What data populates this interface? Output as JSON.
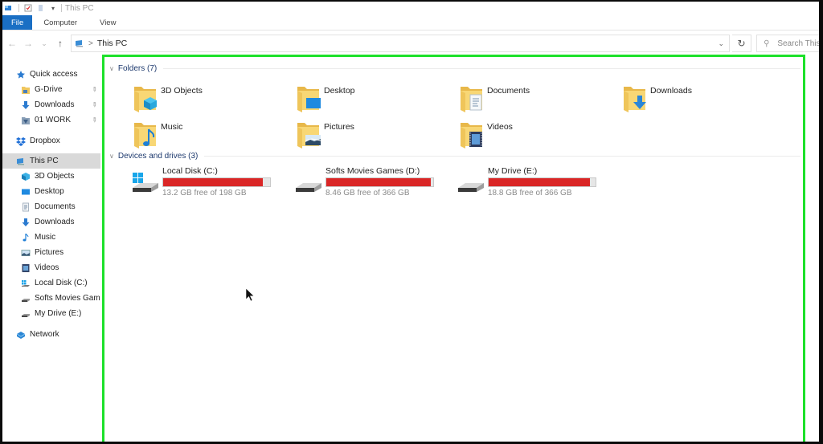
{
  "window": {
    "title": "This PC",
    "quick_access_toolbar": [
      "properties-icon",
      "new-folder-icon",
      "customize-dropdown-icon"
    ]
  },
  "ribbon": {
    "tabs": [
      {
        "label": "File",
        "active": true
      },
      {
        "label": "Computer",
        "active": false
      },
      {
        "label": "View",
        "active": false
      }
    ]
  },
  "navigation": {
    "back_icon": "←",
    "forward_icon": "→",
    "recent_icon": "⌄",
    "up_icon": "↑",
    "breadcrumb": [
      "This PC"
    ],
    "breadcrumb_separator": ">",
    "refresh_icon": "↻",
    "search_placeholder": "Search This PC"
  },
  "sidebar": {
    "items": [
      {
        "label": "Quick access",
        "icon": "star-icon",
        "level": 0,
        "pinned": false
      },
      {
        "label": "G-Drive",
        "icon": "folder-icon",
        "level": 1,
        "pinned": true
      },
      {
        "label": "Downloads",
        "icon": "download-icon",
        "level": 1,
        "pinned": true
      },
      {
        "label": "01 WORK",
        "icon": "work-folder-icon",
        "level": 1,
        "pinned": true
      },
      {
        "label": "Dropbox",
        "icon": "dropbox-icon",
        "level": 0,
        "pinned": false
      },
      {
        "label": "This PC",
        "icon": "pc-icon",
        "level": 0,
        "pinned": false,
        "selected": true
      },
      {
        "label": "3D Objects",
        "icon": "cube-icon",
        "level": 1,
        "pinned": false
      },
      {
        "label": "Desktop",
        "icon": "desktop-icon",
        "level": 1,
        "pinned": false
      },
      {
        "label": "Documents",
        "icon": "document-icon",
        "level": 1,
        "pinned": false
      },
      {
        "label": "Downloads",
        "icon": "download-icon",
        "level": 1,
        "pinned": false
      },
      {
        "label": "Music",
        "icon": "music-icon",
        "level": 1,
        "pinned": false
      },
      {
        "label": "Pictures",
        "icon": "picture-icon",
        "level": 1,
        "pinned": false
      },
      {
        "label": "Videos",
        "icon": "video-icon",
        "level": 1,
        "pinned": false
      },
      {
        "label": "Local Disk (C:)",
        "icon": "windows-drive-icon",
        "level": 1,
        "pinned": false
      },
      {
        "label": "Softs Movies Games (D:)",
        "icon": "drive-icon",
        "level": 1,
        "pinned": false
      },
      {
        "label": "My Drive (E:)",
        "icon": "drive-icon",
        "level": 1,
        "pinned": false
      },
      {
        "label": "Network",
        "icon": "network-icon",
        "level": 0,
        "pinned": false
      }
    ],
    "pin_icon": "📌"
  },
  "content": {
    "folders_header": "Folders (7)",
    "folders": [
      {
        "name": "3D Objects",
        "icon": "cube"
      },
      {
        "name": "Desktop",
        "icon": "desktop"
      },
      {
        "name": "Documents",
        "icon": "document"
      },
      {
        "name": "Downloads",
        "icon": "download"
      },
      {
        "name": "Music",
        "icon": "music"
      },
      {
        "name": "Pictures",
        "icon": "picture"
      },
      {
        "name": "Videos",
        "icon": "video"
      }
    ],
    "drives_header": "Devices and drives (3)",
    "drives": [
      {
        "name": "Local Disk (C:)",
        "free_text": "13.2 GB free of 198 GB",
        "used_fraction": 0.933,
        "windows": true
      },
      {
        "name": "Softs Movies Games (D:)",
        "free_text": "8.46 GB free of 366 GB",
        "used_fraction": 0.977,
        "windows": false
      },
      {
        "name": "My Drive (E:)",
        "free_text": "18.8 GB free of 366 GB",
        "used_fraction": 0.949,
        "windows": false
      }
    ]
  },
  "colors": {
    "file_tab": "#1a6fc4",
    "highlight_border": "#1de12a",
    "drive_bar_full": "#da2626",
    "selected_item": "#d9d9d9"
  }
}
